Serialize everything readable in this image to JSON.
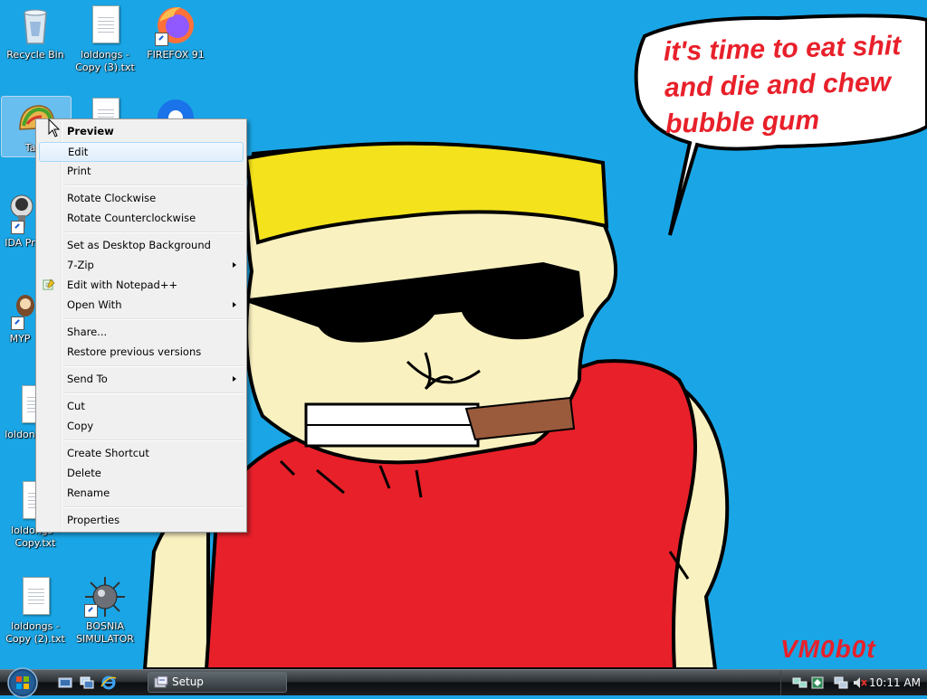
{
  "desktop": {
    "icons": [
      {
        "label": "Recycle Bin"
      },
      {
        "label": "loldongs -\nCopy (3).txt"
      },
      {
        "label": "FIREFOX 91"
      },
      {
        "label": "Taco"
      },
      {
        "label": "IDA Pr"
      },
      {
        "label": "MYP"
      },
      {
        "label": "loldon"
      },
      {
        "label": "loldongs -\nCopy.txt"
      },
      {
        "label": "loldongs -\nCopy (2).txt"
      },
      {
        "label": "BOSNIA\nSIMULATOR"
      }
    ]
  },
  "wallpaper": {
    "speech_lines": [
      "it's time to eat shit",
      "and die and chew",
      "bubble gum"
    ],
    "signature": "VM0b0t",
    "colors": {
      "sky": "#1aa6e6",
      "hair": "#f4e21c",
      "shirt": "#e8202a",
      "skin": "#faf1c0",
      "cigar": "#9a5a3c"
    }
  },
  "context_menu": {
    "items": [
      {
        "label": "Preview",
        "bold": true
      },
      {
        "label": "Edit",
        "highlighted": true
      },
      {
        "label": "Print"
      },
      {
        "label": "Rotate Clockwise"
      },
      {
        "label": "Rotate Counterclockwise"
      },
      {
        "label": "Set as Desktop Background"
      },
      {
        "label": "7-Zip",
        "submenu": true
      },
      {
        "label": "Edit with Notepad++",
        "icon": "notepad-plus-plus-icon"
      },
      {
        "label": "Open With",
        "submenu": true
      },
      {
        "label": "Share..."
      },
      {
        "label": "Restore previous versions"
      },
      {
        "label": "Send To",
        "submenu": true
      },
      {
        "label": "Cut"
      },
      {
        "label": "Copy"
      },
      {
        "label": "Create Shortcut"
      },
      {
        "label": "Delete"
      },
      {
        "label": "Rename"
      },
      {
        "label": "Properties"
      }
    ]
  },
  "taskbar": {
    "tasks": [
      {
        "label": "Setup"
      }
    ],
    "clock": "10:11 AM"
  }
}
